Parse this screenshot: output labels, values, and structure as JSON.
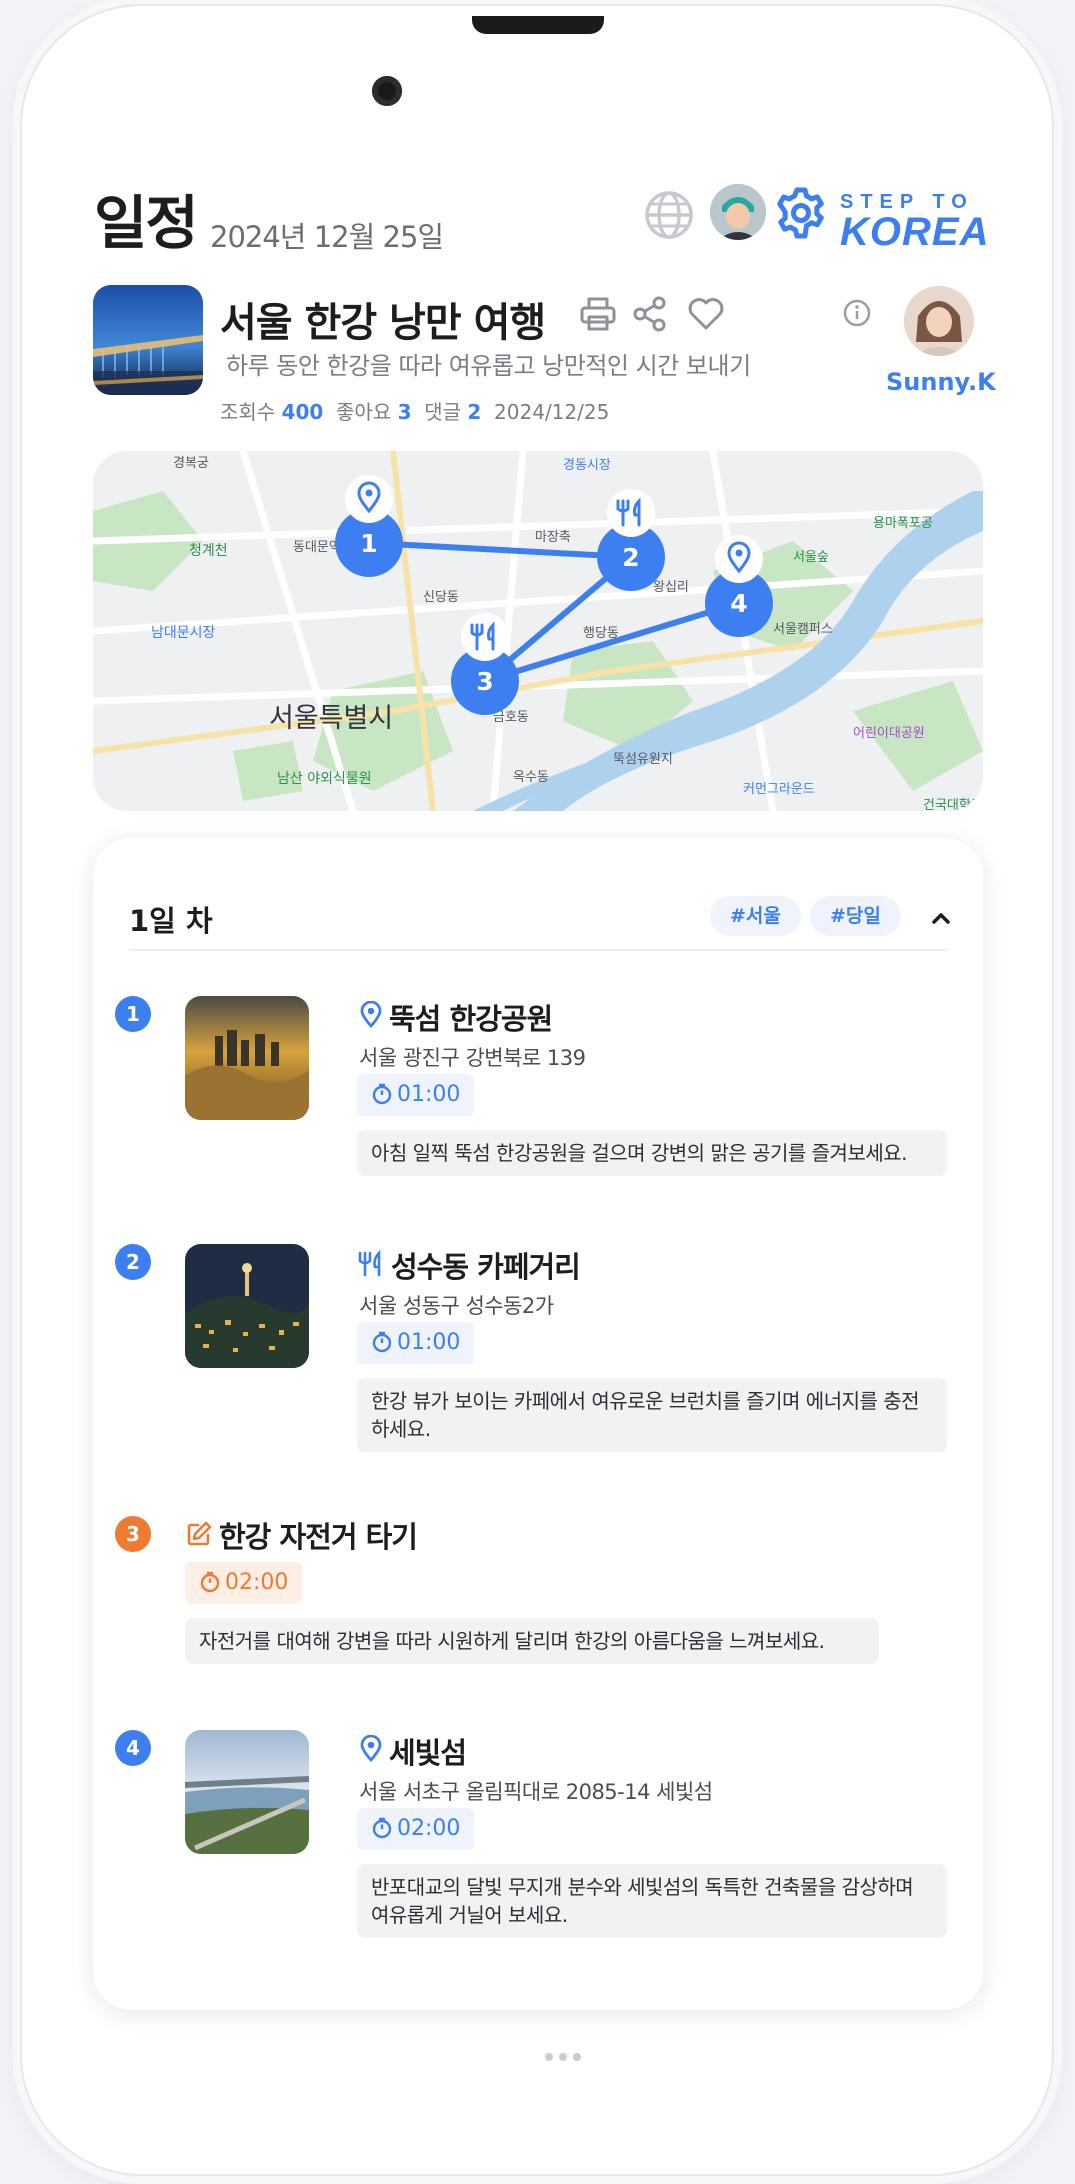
{
  "header": {
    "title": "일정",
    "date": "2024년 12월 25일",
    "brand_line1": "STEP TO",
    "brand_line2": "KOREA"
  },
  "trip": {
    "title": "서울 한강 낭만 여행",
    "description": "하루 동안 한강을 따라 여유롭고 낭만적인 시간 보내기",
    "meta": {
      "views_label": "조회수",
      "views": "400",
      "likes_label": "좋아요",
      "likes": "3",
      "comments_label": "댓글",
      "comments": "2",
      "date": "2024/12/25"
    },
    "author": "Sunny.K"
  },
  "map": {
    "labels": {
      "gyeongbokgung": "경복궁",
      "cheonggyecheon": "청계천",
      "namdaemun": "남대문시장",
      "seoul": "서울특별시",
      "namsan": "남산 야외식물원",
      "seoulforest": "서울숲",
      "majang": "마장축",
      "cheonggyechon": "경동시장",
      "yongmapokpo": "용마폭포공",
      "campus": "서울캠퍼스",
      "childrenpark": "어린이대공원",
      "ttukseom": "뚝섬유원지",
      "commongrounds": "커먼그라운드",
      "konkuk": "건국대학교",
      "dongdaemun": "동대문역사문화공원",
      "haengdang": "행당동",
      "geumho": "금호동",
      "oksu": "옥수동",
      "sindang": "신당동",
      "wangsimni": "왕십리"
    },
    "markers": [
      "1",
      "2",
      "3",
      "4"
    ]
  },
  "itinerary": {
    "day_label": "1일 차",
    "tags": [
      "#서울",
      "#당일"
    ],
    "stops": [
      {
        "num": "1",
        "title": "뚝섬 한강공원",
        "address": "서울 광진구 강변북로 139",
        "duration": "01:00",
        "note": "아침 일찍 뚝섬 한강공원을 걸으며 강변의 맑은 공기를 즐겨보세요.",
        "icon": "location-pin-icon"
      },
      {
        "num": "2",
        "title": "성수동 카페거리",
        "address": "서울 성동구 성수동2가",
        "duration": "01:00",
        "note": "한강 뷰가 보이는 카페에서 여유로운 브런치를 즐기며 에너지를 충전하세요.",
        "icon": "fork-knife-icon"
      },
      {
        "num": "3",
        "title": "한강 자전거 타기",
        "duration": "02:00",
        "note": "자전거를 대여해 강변을 따라 시원하게 달리며 한강의 아름다움을 느껴보세요.",
        "icon": "edit-icon"
      },
      {
        "num": "4",
        "title": "세빛섬",
        "address": "서울 서초구 올림픽대로 2085-14 세빛섬",
        "duration": "02:00",
        "note": "반포대교의 달빛 무지개 분수와 세빛섬의 독특한 건축물을 감상하며 여유롭게 거닐어 보세요.",
        "icon": "location-pin-icon"
      }
    ]
  },
  "colors": {
    "accent": "#3d7ff0",
    "orange": "#ef7a32",
    "text": "#1d1d1f",
    "muted": "#7a7d85"
  }
}
